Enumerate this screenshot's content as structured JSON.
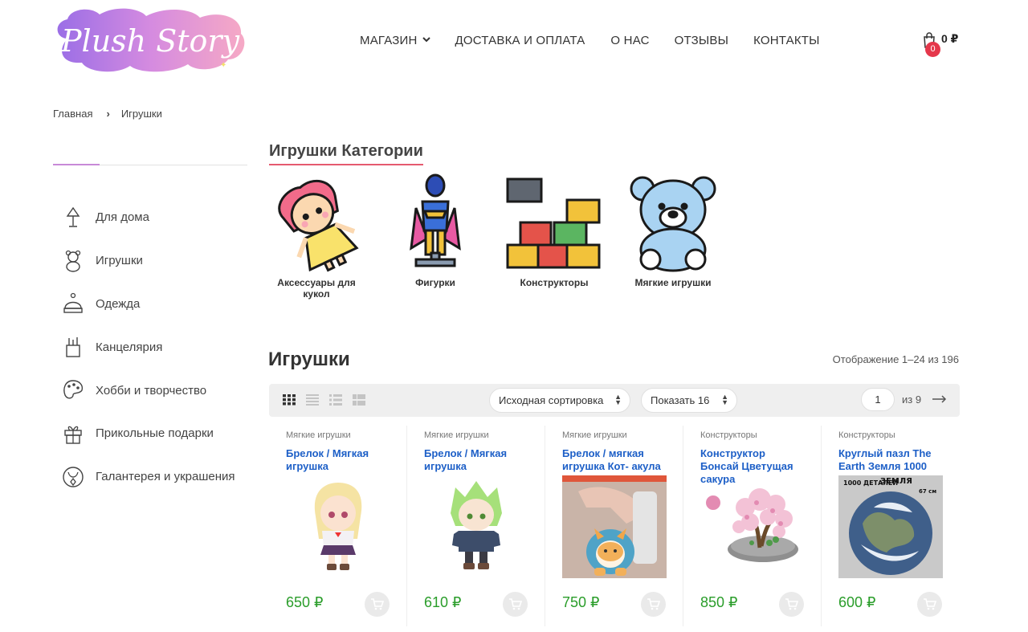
{
  "brand": {
    "logo_text": "Plush Story"
  },
  "nav": {
    "items": [
      {
        "label": "МАГАЗИН",
        "has_dropdown": true
      },
      {
        "label": "ДОСТАВКА И ОПЛАТА"
      },
      {
        "label": "О НАС"
      },
      {
        "label": "ОТЗЫВЫ"
      },
      {
        "label": "КОНТАКТЫ"
      }
    ]
  },
  "cart": {
    "count": "0",
    "total": "0 ₽",
    "icon": "shopping-bag-icon"
  },
  "breadcrumb": {
    "home": "Главная",
    "current": "Игрушки",
    "separator": "›"
  },
  "sidebar": {
    "items": [
      {
        "label": "Для дома",
        "icon": "lamp-icon"
      },
      {
        "label": "Игрушки",
        "icon": "teddy-bear-icon"
      },
      {
        "label": "Одежда",
        "icon": "knit-hat-icon"
      },
      {
        "label": "Канцелярия",
        "icon": "pencil-cup-icon"
      },
      {
        "label": "Хобби и творчество",
        "icon": "palette-icon"
      },
      {
        "label": "Прикольные подарки",
        "icon": "gift-icon"
      },
      {
        "label": "Галантерея и украшения",
        "icon": "necklace-icon"
      }
    ]
  },
  "categories": {
    "title": "Игрушки Категории",
    "items": [
      {
        "name": "Аксессуары для кукол",
        "icon": "doll-icon"
      },
      {
        "name": "Фигурки",
        "icon": "superhero-figure-icon"
      },
      {
        "name": "Конструкторы",
        "icon": "building-blocks-icon"
      },
      {
        "name": "Мягкие игрушки",
        "icon": "plush-bear-icon"
      }
    ]
  },
  "products": {
    "title": "Игрушки",
    "showing": "Отображение 1–24 из 196",
    "sort_label": "Исходная сортировка",
    "per_page_label": "Показать 16",
    "page": "1",
    "of_pages": "из 9",
    "items": [
      {
        "category": "Мягкие игрушки",
        "title": "Брелок / Мягкая игрушка",
        "price": "650 ₽"
      },
      {
        "category": "Мягкие игрушки",
        "title": "Брелок / Мягкая игрушка",
        "price": "610 ₽"
      },
      {
        "category": "Мягкие игрушки",
        "title": "Брелок / мягкая игрушка Кот- акула",
        "price": "750 ₽"
      },
      {
        "category": "Конструкторы",
        "title": "Конструктор Бонсай Цветущая сакура",
        "price": "850 ₽"
      },
      {
        "category": "Конструкторы",
        "title": "Круглый пазл The Earth Земля 1000",
        "price": "600 ₽",
        "image_text": [
          "1000 ДЕТАЛЕЙ",
          "ЗЕМЛЯ",
          "67 см"
        ]
      }
    ]
  },
  "colors": {
    "accent_pink": "#e55a6f",
    "price_green": "#2a9d2a",
    "link_blue": "#1d5fc7",
    "badge_red": "#e5374b"
  }
}
